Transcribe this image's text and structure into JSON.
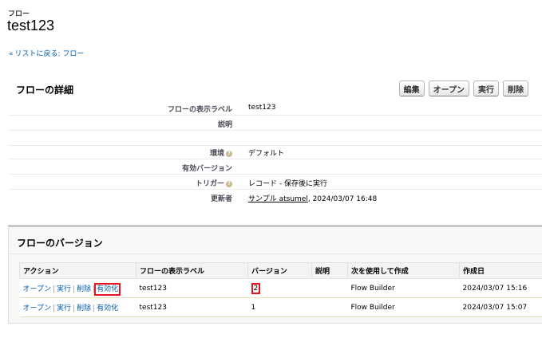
{
  "header": {
    "object_label": "フロー",
    "title": "test123"
  },
  "back_link": {
    "chevron": "«",
    "label": "リストに戻る: フロー"
  },
  "detail": {
    "title": "フローの詳細",
    "buttons": {
      "edit": "編集",
      "open": "オープン",
      "run": "実行",
      "delete": "削除"
    },
    "rows": [
      {
        "label": "フローの表示ラベル",
        "value": "test123"
      },
      {
        "label": "説明",
        "value": ""
      },
      {
        "label": "",
        "value": ""
      },
      {
        "label": "環境",
        "value": "デフォルト"
      },
      {
        "label": "有効バージョン",
        "value": ""
      },
      {
        "label": "トリガー",
        "value": "レコード - 保存後に実行"
      }
    ],
    "modified": {
      "label": "更新者",
      "user": "サンプル atsumel",
      "date": ", 2024/03/07 16:48"
    }
  },
  "versions": {
    "title": "フローのバージョン",
    "columns": [
      "アクション",
      "フローの表示ラベル",
      "バージョン",
      "説明",
      "次を使用して作成",
      "作成日"
    ],
    "action_labels": {
      "open": "オープン",
      "run": "実行",
      "delete": "削除",
      "activate": "有効化"
    },
    "rows": [
      {
        "label": "test123",
        "version": "2",
        "description": "",
        "created_with": "Flow Builder",
        "created": "2024/03/07 15:16"
      },
      {
        "label": "test123",
        "version": "1",
        "description": "",
        "created_with": "Flow Builder",
        "created": "2024/03/07 15:07"
      }
    ]
  },
  "colors": {
    "link": "#015ba7",
    "highlight": "#e8131e"
  }
}
